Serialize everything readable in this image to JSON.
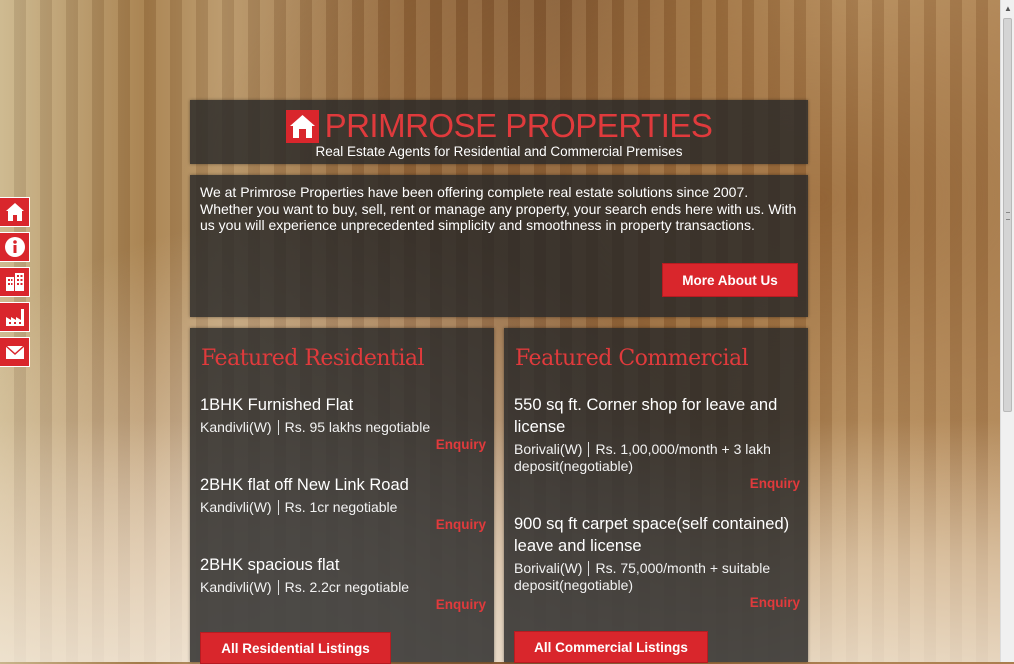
{
  "site": {
    "brand": "PRIMROSE PROPERTIES",
    "tagline": "Real Estate Agents for Residential and Commercial Premises",
    "accent_color": "#d9262c"
  },
  "sidenav": {
    "items": [
      {
        "icon": "home-icon"
      },
      {
        "icon": "info-icon"
      },
      {
        "icon": "building-icon"
      },
      {
        "icon": "factory-icon"
      },
      {
        "icon": "mail-icon"
      }
    ]
  },
  "about": {
    "text": "We at Primrose Properties have been offering complete real estate solutions since 2007. Whether you want to buy, sell, rent or manage any property, your search ends here with us. With us you will experience unprecedented simplicity and smoothness in property transactions.",
    "button": "More About Us"
  },
  "residential": {
    "title": "Featured Residential",
    "listings": [
      {
        "title": "1BHK Furnished Flat",
        "location": "Kandivli(W)",
        "price": "Rs. 95 lakhs negotiable",
        "enquiry": "Enquiry"
      },
      {
        "title": "2BHK flat off New Link Road",
        "location": "Kandivli(W)",
        "price": "Rs. 1cr negotiable",
        "enquiry": "Enquiry"
      },
      {
        "title": "2BHK spacious flat",
        "location": "Kandivli(W)",
        "price": "Rs. 2.2cr negotiable",
        "enquiry": "Enquiry"
      }
    ],
    "all_button": "All Residential Listings"
  },
  "commercial": {
    "title": "Featured Commercial",
    "listings": [
      {
        "title": "550 sq ft. Corner shop for leave and license",
        "location": "Borivali(W)",
        "price": "Rs. 1,00,000/month + 3 lakh deposit(negotiable)",
        "enquiry": "Enquiry"
      },
      {
        "title": "900 sq ft carpet space(self contained) leave and license",
        "location": "Borivali(W)",
        "price": "Rs. 75,000/month + suitable deposit(negotiable)",
        "enquiry": "Enquiry"
      }
    ],
    "all_button": "All Commercial Listings"
  }
}
